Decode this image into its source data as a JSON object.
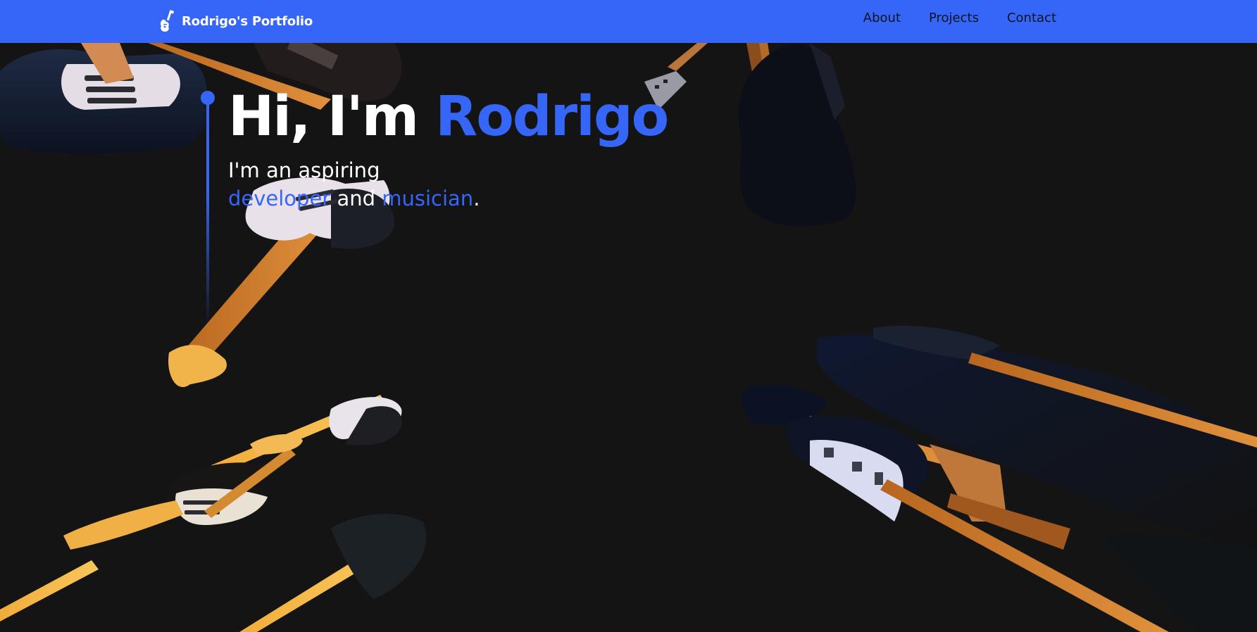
{
  "nav": {
    "brand_title": "Rodrigo's Portfolio",
    "brand_icon": "guitar-icon",
    "links": [
      {
        "label": "About"
      },
      {
        "label": "Projects"
      },
      {
        "label": "Contact"
      }
    ]
  },
  "hero": {
    "greeting": "Hi, I'm",
    "name": "Rodrigo",
    "line1": "I'm an aspiring",
    "role1": "developer",
    "conjunction": "and",
    "role2": "musician",
    "period": "."
  },
  "colors": {
    "accent": "#3566f7",
    "background": "#141414",
    "text": "#ffffff",
    "nav_link": "#10131c"
  }
}
